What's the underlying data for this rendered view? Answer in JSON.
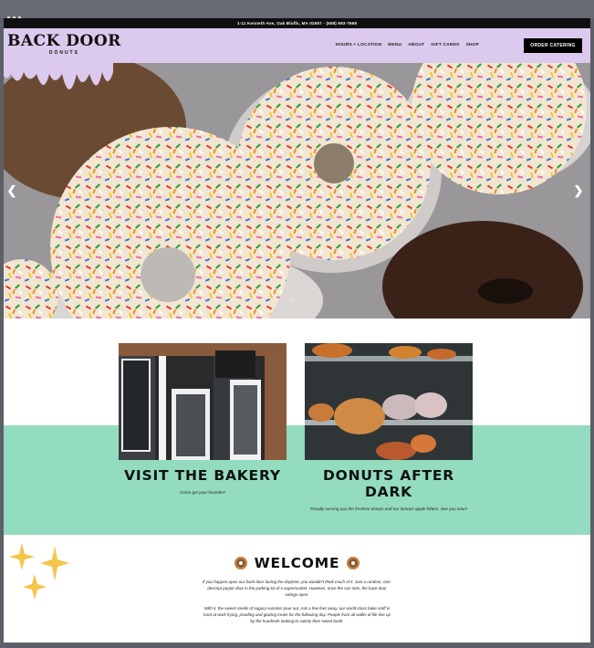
{
  "topbar": {
    "address": "1-11 Kenneth Ave, Oak Bluffs, MA 02557   ·   (508) 693-7668"
  },
  "brand": {
    "name": "BACK DOOR",
    "sub": "DONUTS"
  },
  "nav": {
    "items": [
      "HOURS + LOCATION",
      "MENU",
      "ABOUT",
      "GIFT CARDS",
      "SHOP"
    ],
    "cta": "ORDER CATERING"
  },
  "hero": {
    "prev_icon": "chevron-left-icon",
    "next_icon": "chevron-right-icon",
    "play_icon": "play-icon"
  },
  "cards": [
    {
      "title": "VISIT THE BAKERY",
      "text": "Come get your favorites!"
    },
    {
      "title": "DONUTS AFTER DARK",
      "text": "Proudly serving you the freshest donuts and our famous apple fritters. See you soon!"
    }
  ],
  "welcome": {
    "title": "WELCOME",
    "p1": "If you happen upon our back door during the daytime, you wouldn't think much of it. Just a random, non-descript purple door in the parking lot of a supermarket. However, once the sun sets, the back door swings open.",
    "p2": "With it, the sweet smells of sugary summer pour out. Ask a few feet away, our world-class bake staff is hard at work frying, proofing and glazing treats for the following day. People from all walks of life line up by the hundreds looking to satisfy their sweet tooth."
  },
  "colors": {
    "header": "#dcc9ee",
    "mint": "#93dcbf",
    "accent": "#000000"
  }
}
